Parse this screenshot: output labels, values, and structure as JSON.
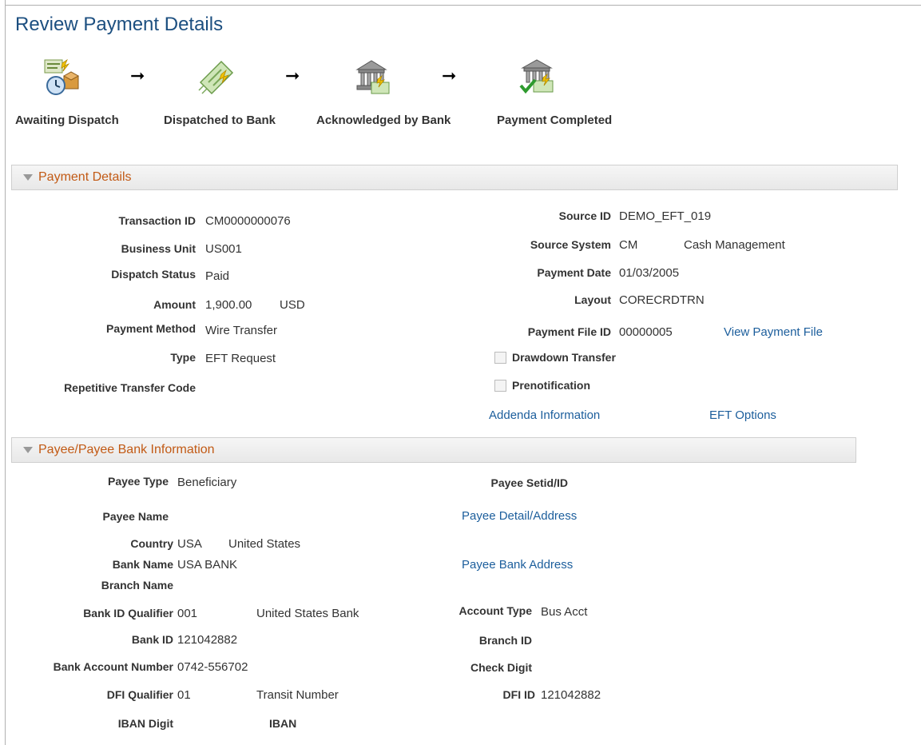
{
  "page": {
    "title": "Review Payment Details"
  },
  "steps": [
    {
      "label": "Awaiting Dispatch",
      "icon": "awaiting-dispatch-icon"
    },
    {
      "label": "Dispatched to Bank",
      "icon": "dispatched-to-bank-icon"
    },
    {
      "label": "Acknowledged by Bank",
      "icon": "acknowledged-by-bank-icon"
    },
    {
      "label": "Payment Completed",
      "icon": "payment-completed-icon"
    }
  ],
  "step_arrow": "➞",
  "payment_details": {
    "section_title": "Payment Details",
    "transaction_id": {
      "label": "Transaction ID",
      "value": "CM0000000076"
    },
    "business_unit": {
      "label": "Business Unit",
      "value": "US001"
    },
    "dispatch_status": {
      "label": "Dispatch Status",
      "value": "Paid"
    },
    "amount": {
      "label": "Amount",
      "value": "1,900.00",
      "currency": "USD"
    },
    "payment_method": {
      "label": "Payment Method",
      "value": "Wire Transfer"
    },
    "type": {
      "label": "Type",
      "value": "EFT Request"
    },
    "repetitive_transfer_code": {
      "label": "Repetitive Transfer Code",
      "value": ""
    },
    "source_id": {
      "label": "Source ID",
      "value": "DEMO_EFT_019"
    },
    "source_system": {
      "label": "Source System",
      "code": "CM",
      "name": "Cash Management"
    },
    "payment_date": {
      "label": "Payment Date",
      "value": "01/03/2005"
    },
    "layout": {
      "label": "Layout",
      "value": "CORECRDTRN"
    },
    "payment_file_id": {
      "label": "Payment File ID",
      "value": "00000005"
    },
    "view_payment_file": "View Payment File",
    "drawdown_transfer": {
      "label": "Drawdown Transfer",
      "checked": false
    },
    "prenotification": {
      "label": "Prenotification",
      "checked": false
    },
    "addenda_information": "Addenda Information",
    "eft_options": "EFT Options"
  },
  "payee": {
    "section_title": "Payee/Payee Bank Information",
    "payee_type": {
      "label": "Payee Type",
      "value": "Beneficiary"
    },
    "payee_setid": {
      "label": "Payee Setid/ID",
      "value": ""
    },
    "payee_name": {
      "label": "Payee Name",
      "value": ""
    },
    "payee_detail_address": "Payee Detail/Address",
    "country": {
      "label": "Country",
      "code": "USA",
      "name": "United States"
    },
    "bank_name": {
      "label": "Bank Name",
      "value": "USA BANK"
    },
    "payee_bank_address": "Payee Bank Address",
    "branch_name": {
      "label": "Branch Name",
      "value": ""
    },
    "bank_id_qualifier": {
      "label": "Bank ID Qualifier",
      "code": "001",
      "name": "United States Bank"
    },
    "account_type": {
      "label": "Account Type",
      "value": "Bus Acct"
    },
    "bank_id": {
      "label": "Bank ID",
      "value": "121042882"
    },
    "branch_id": {
      "label": "Branch ID",
      "value": ""
    },
    "bank_account_number": {
      "label": "Bank Account Number",
      "value": "0742-556702"
    },
    "check_digit": {
      "label": "Check Digit",
      "value": ""
    },
    "dfi_qualifier": {
      "label": "DFI Qualifier",
      "code": "01",
      "name": "Transit Number"
    },
    "dfi_id": {
      "label": "DFI ID",
      "value": "121042882"
    },
    "iban_digit": {
      "label": "IBAN Digit",
      "value": ""
    },
    "iban": {
      "label": "IBAN",
      "value": ""
    }
  }
}
